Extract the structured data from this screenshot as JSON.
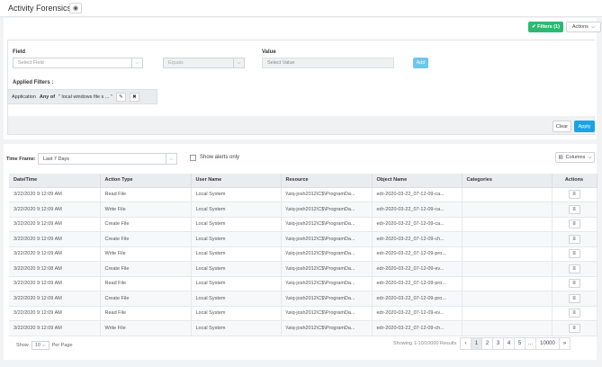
{
  "header": {
    "title": "Activity Forensics",
    "toggle_icon": "eye-icon"
  },
  "toolbar": {
    "filters_label": "✔ Filters (1)",
    "actions_label": "Actions",
    "actions_caret": "⌵"
  },
  "builder": {
    "field_label": "Field",
    "field_placeholder": "Select Field",
    "operator_placeholder": "Equals",
    "value_label": "Value",
    "value_placeholder": "Select Value",
    "add_label": "Add",
    "applied_label": "Applied Filters :",
    "chip": {
      "field": "Application",
      "op": "Any of",
      "value": "\" local windows file s ... \"",
      "edit_icon": "✎",
      "remove_icon": "✖"
    },
    "clear_label": "Clear",
    "apply_label": "Apply"
  },
  "controls": {
    "timeframe_label": "Time Frame:",
    "timeframe_value": "Last 7 Days",
    "show_alerts_label": "Show alerts only",
    "columns_label": "Columns",
    "columns_icon": "▥",
    "caret": "⌵"
  },
  "table": {
    "columns": [
      "Date/Time",
      "Action Type",
      "User Name",
      "Resource",
      "Object Name",
      "Categories",
      "Actions"
    ],
    "rows": [
      [
        "3/22/2020 9:12:09 AM",
        "Read File",
        "Local System",
        "\\\\siq-josh2012\\C$\\ProgramDa...",
        "edr-2020-03-22_07-12-09-ca...",
        ""
      ],
      [
        "3/22/2020 9:12:09 AM",
        "Write File",
        "Local System",
        "\\\\siq-josh2012\\C$\\ProgramDa...",
        "edr-2020-03-22_07-12-09-ca...",
        ""
      ],
      [
        "3/22/2020 9:12:09 AM",
        "Create File",
        "Local System",
        "\\\\siq-josh2012\\C$\\ProgramDa...",
        "edr-2020-03-22_07-12-09-ca...",
        ""
      ],
      [
        "3/22/2020 9:12:09 AM",
        "Create File",
        "Local System",
        "\\\\siq-josh2012\\C$\\ProgramDa...",
        "edr-2020-03-22_07-12-09-ch...",
        ""
      ],
      [
        "3/22/2020 9:12:09 AM",
        "Write File",
        "Local System",
        "\\\\siq-josh2012\\C$\\ProgramDa...",
        "edr-2020-03-22_07-12-09-pro...",
        ""
      ],
      [
        "3/22/2020 9:12:08 AM",
        "Create File",
        "Local System",
        "\\\\siq-josh2012\\C$\\ProgramDa...",
        "edr-2020-03-22_07-12-09-ev...",
        ""
      ],
      [
        "3/22/2020 9:12:09 AM",
        "Read File",
        "Local System",
        "\\\\siq-josh2012\\C$\\ProgramDa...",
        "edr-2020-03-22_07-12-09-pro...",
        ""
      ],
      [
        "3/22/2020 9:12:09 AM",
        "Create File",
        "Local System",
        "\\\\siq-josh2012\\C$\\ProgramDa...",
        "edr-2020-03-22_07-12-09-pro...",
        ""
      ],
      [
        "3/22/2020 9:12:09 AM",
        "Read File",
        "Local System",
        "\\\\siq-josh2012\\C$\\ProgramDa...",
        "edr-2020-03-22_07-12-09-ev...",
        ""
      ],
      [
        "3/22/2020 9:12:09 AM",
        "Write File",
        "Local System",
        "\\\\siq-josh2012\\C$\\ProgramDa...",
        "edr-2020-03-22_07-12-09-ch...",
        ""
      ]
    ],
    "row_menu_icon": "≡"
  },
  "footer": {
    "show_label": "Show",
    "per_page_value": "10",
    "per_page_label": "Per Page",
    "showing_text": "Showing 1-10/10000 Results",
    "pages": [
      "‹",
      "1",
      "2",
      "3",
      "4",
      "5",
      "...",
      "10000",
      "»"
    ],
    "active_page": "1"
  }
}
